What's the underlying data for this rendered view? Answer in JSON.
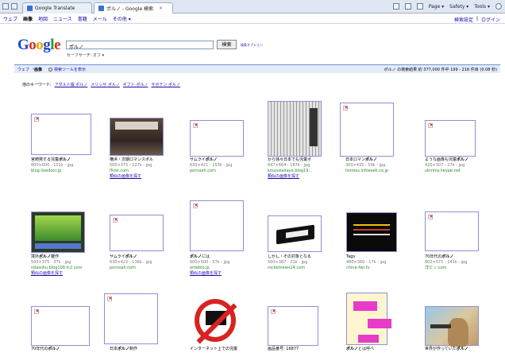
{
  "browser": {
    "tabs": [
      {
        "label": "Google Translate"
      },
      {
        "label": "ポルノ - Google 検索"
      }
    ],
    "toolbar_right": [
      "Page ▾",
      "Safety ▾",
      "Tools ▾"
    ]
  },
  "gnav": {
    "items": [
      "ウェブ",
      "画像",
      "地図",
      "ニュース",
      "書籍",
      "メール",
      "その他 ▾"
    ],
    "right": [
      "検索設定",
      "ログイン"
    ]
  },
  "search": {
    "logo": "Google",
    "query": "ポルノ",
    "button": "検索",
    "advanced": "検索オプション",
    "safesearch": "セーフサーチ: オフ ▾"
  },
  "results_bar": {
    "tabs": [
      "ウェブ",
      "画像"
    ],
    "option": "検索ツールを表示",
    "stats": "ポルノ の検索結果 約 377,000 件中 199 - 216 件目 (0.08 秒)"
  },
  "related": {
    "label": "他のキーワード:",
    "links": [
      "アダルト版 ポルノ",
      "メリッサ ポルノ",
      "ギフト ポルノ",
      "サボテン ポルノ"
    ]
  },
  "results": [
    {
      "title": "宮崎発する児童ポルノ",
      "dims": "800×600 - 101k - jpg",
      "url": "blog.livedoor.jp",
      "similar": ""
    },
    {
      "title": "横浜・次期ロマンスポル",
      "dims": "500×375 - 127k - jpg",
      "url": "flickr.com",
      "similar": "類似の画像を探す"
    },
    {
      "title": "サムライポルノ",
      "dims": "630×421 - 153k - jpg",
      "url": "pornoah.com",
      "similar": ""
    },
    {
      "title": "から徐々日本でも児童ポ",
      "dims": "647×664 - 187k - jpg",
      "url": "kouzusadaya.blog19...",
      "similar": "類似の画像を探す"
    },
    {
      "title": "日本ロマンポルノ",
      "dims": "300×435 - 59k - jpg",
      "url": "hstress.infoseek.co.jp",
      "similar": ""
    },
    {
      "title": "ような画像も児童ポルノ",
      "dims": "420×307 - 27k - jpg",
      "url": "ukmmy.heype.net",
      "similar": ""
    },
    {
      "title": "境外ポルノ雑作",
      "dims": "500×375 - 37k - jpg",
      "url": "ndasoku.blog108.fc2.com",
      "similar": "類似の画像を探す"
    },
    {
      "title": "サムライポルノ",
      "dims": "630×422 - 136k - jpg",
      "url": "pornoah.com",
      "similar": ""
    },
    {
      "title": "ポルノには",
      "dims": "600×500 - 37k - jpg",
      "url": "ameblo.jp",
      "similar": "類似の画像を探す"
    },
    {
      "title": "しかし・その対象となる",
      "dims": "500×387 - 21k - jpg",
      "url": "rocketnews24.com",
      "similar": ""
    },
    {
      "title": "Tags",
      "dims": "480×360 - 17k - jpg",
      "url": "china-fan.tv",
      "similar": ""
    },
    {
      "title": "70年代のポルノ",
      "dims": "802×571 - 141k - jpg",
      "url": "洋ピン.com",
      "similar": ""
    },
    {
      "title": "70年代のポルノ",
      "dims": "",
      "url": "",
      "similar": ""
    },
    {
      "title": "日本ポルノ制作",
      "dims": "",
      "url": "",
      "similar": ""
    },
    {
      "title": "インターネット上での児童",
      "dims": "",
      "url": "",
      "similar": ""
    },
    {
      "title": "画品番号: 16877",
      "dims": "",
      "url": "",
      "similar": ""
    },
    {
      "title": "ポルノとは呼べ",
      "dims": "",
      "url": "",
      "similar": ""
    },
    {
      "title": "世界が作っていたポルノ",
      "dims": "",
      "url": "",
      "similar": ""
    }
  ]
}
